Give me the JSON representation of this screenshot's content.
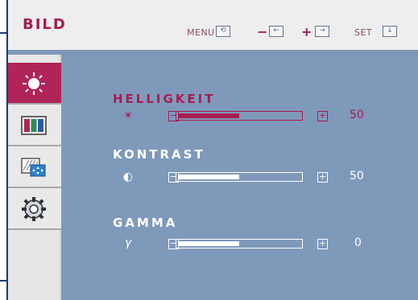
{
  "header": {
    "title": "BILD",
    "menu_label": "MENU",
    "set_label": "SET",
    "menu_icon": "menu-exit-icon",
    "minus_symbol": "−",
    "minus_icon": "left-arrow-box-icon",
    "plus_symbol": "+",
    "plus_icon": "right-arrow-box-icon",
    "set_icon": "down-arrow-box-icon"
  },
  "sidebar": {
    "items": [
      {
        "name": "brightness",
        "icon": "sun-icon",
        "active": true
      },
      {
        "name": "color",
        "icon": "color-bars-icon",
        "active": false
      },
      {
        "name": "position",
        "icon": "screen-position-icon",
        "active": false
      },
      {
        "name": "setup",
        "icon": "gear-icon",
        "active": false
      }
    ]
  },
  "rows": [
    {
      "label": "HELLIGKEIT",
      "icon": "sun-small-icon",
      "icon_glyph": "☀",
      "value": "50",
      "level": 0.5,
      "active": true
    },
    {
      "label": "KONTRAST",
      "icon": "contrast-icon",
      "icon_glyph": "◐",
      "value": "50",
      "level": 0.5,
      "active": false
    },
    {
      "label": "GAMMA",
      "icon": "gamma-icon",
      "icon_glyph": "γ",
      "value": "0",
      "level": 0.5,
      "active": false
    }
  ],
  "colors": {
    "accent": "#a61d50",
    "panel": "#7f99bb",
    "header_bg": "#eeeeee",
    "frame": "#1d3a6e"
  }
}
